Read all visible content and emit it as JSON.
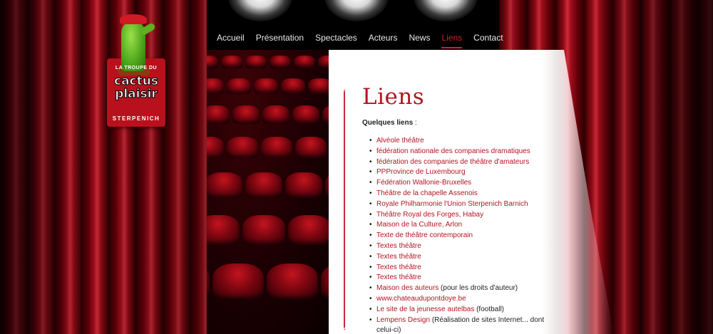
{
  "logo": {
    "line1": "LA TROUPE DU",
    "line2": "cactus",
    "line3": "plaisir",
    "line4": "STERPENICH"
  },
  "nav": [
    {
      "label": "Accueil",
      "active": false
    },
    {
      "label": "Présentation",
      "active": false
    },
    {
      "label": "Spectacles",
      "active": false
    },
    {
      "label": "Acteurs",
      "active": false
    },
    {
      "label": "News",
      "active": false
    },
    {
      "label": "Liens",
      "active": true
    },
    {
      "label": "Contact",
      "active": false
    }
  ],
  "page": {
    "title": "Liens",
    "intro": "Quelques liens",
    "intro_colon": " :"
  },
  "links": [
    {
      "text": "Alvéole théâtre",
      "suffix": ""
    },
    {
      "text": "fédération nationale des companies dramatiques",
      "suffix": ""
    },
    {
      "text": "fédération des companies de théâtre d'amateurs",
      "suffix": ""
    },
    {
      "text": "PPProvince de Luxembourg",
      "suffix": ""
    },
    {
      "text": "Fédération Wallonie-Bruxelles",
      "suffix": ""
    },
    {
      "text": "Théâtre de la chapelle Assenois",
      "suffix": ""
    },
    {
      "text": "Royale Philharmonie l'Union Sterpenich Barnich",
      "suffix": ""
    },
    {
      "text": "Théâtre Royal des Forges, Habay",
      "suffix": ""
    },
    {
      "text": "Maison de la Culture, Arlon",
      "suffix": ""
    },
    {
      "text": "Texte de théâtre contemporain",
      "suffix": ""
    },
    {
      "text": "Textes théâtre",
      "suffix": ""
    },
    {
      "text": "Textes théâtre",
      "suffix": ""
    },
    {
      "text": "Textes théâtre",
      "suffix": ""
    },
    {
      "text": "Textes théâtre",
      "suffix": ""
    },
    {
      "text": "Maison des auteurs",
      "suffix": " (pour les droits d'auteur)"
    },
    {
      "text": "www.chateaudupontdoye.be",
      "suffix": ""
    },
    {
      "text": "Le site de la jeunesse autelbas",
      "suffix": " (football)"
    },
    {
      "text": "Lempens Design",
      "suffix": " (Réalisation de sites Internet... dont"
    },
    {
      "text": "",
      "suffix": "celui-ci)"
    }
  ],
  "colors": {
    "accent": "#b21520",
    "nav_text": "#e8e8e8",
    "nav_active": "#d4202c",
    "panel": "#ffffff"
  },
  "icons": {
    "scroll_up": "up-arrow-icon",
    "scroll_down": "down-arrow-icon"
  }
}
